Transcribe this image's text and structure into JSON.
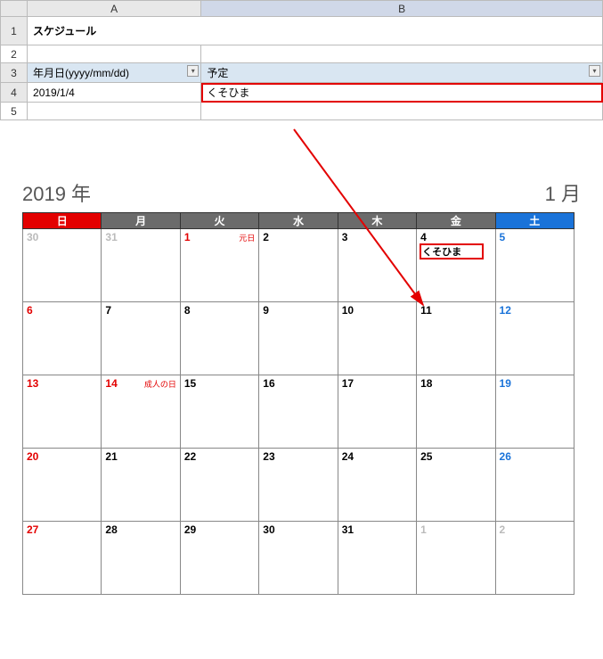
{
  "spreadsheet": {
    "columns": {
      "a": "A",
      "b": "B"
    },
    "rows": [
      "1",
      "2",
      "3",
      "4",
      "5"
    ],
    "title": "スケジュール",
    "header_date": "年月日(yyyy/mm/dd)",
    "header_plan": "予定",
    "data_date": "2019/1/4",
    "data_plan": "くそひま"
  },
  "calendar": {
    "year_label": "2019 年",
    "month_label": "1 月",
    "dow": {
      "sun": "日",
      "mon": "月",
      "tue": "火",
      "wed": "水",
      "thu": "木",
      "fri": "金",
      "sat": "土"
    },
    "weeks": [
      [
        {
          "n": "30",
          "cls": "other"
        },
        {
          "n": "31",
          "cls": "other"
        },
        {
          "n": "1",
          "cls": "holiday",
          "holiday": "元日"
        },
        {
          "n": "2",
          "cls": ""
        },
        {
          "n": "3",
          "cls": ""
        },
        {
          "n": "4",
          "cls": "",
          "event": "くそひま",
          "highlight": true
        },
        {
          "n": "5",
          "cls": "sat"
        }
      ],
      [
        {
          "n": "6",
          "cls": "sun"
        },
        {
          "n": "7",
          "cls": ""
        },
        {
          "n": "8",
          "cls": ""
        },
        {
          "n": "9",
          "cls": ""
        },
        {
          "n": "10",
          "cls": ""
        },
        {
          "n": "11",
          "cls": ""
        },
        {
          "n": "12",
          "cls": "sat"
        }
      ],
      [
        {
          "n": "13",
          "cls": "sun"
        },
        {
          "n": "14",
          "cls": "holiday",
          "holiday": "成人の日"
        },
        {
          "n": "15",
          "cls": ""
        },
        {
          "n": "16",
          "cls": ""
        },
        {
          "n": "17",
          "cls": ""
        },
        {
          "n": "18",
          "cls": ""
        },
        {
          "n": "19",
          "cls": "sat"
        }
      ],
      [
        {
          "n": "20",
          "cls": "sun"
        },
        {
          "n": "21",
          "cls": ""
        },
        {
          "n": "22",
          "cls": ""
        },
        {
          "n": "23",
          "cls": ""
        },
        {
          "n": "24",
          "cls": ""
        },
        {
          "n": "25",
          "cls": ""
        },
        {
          "n": "26",
          "cls": "sat"
        }
      ],
      [
        {
          "n": "27",
          "cls": "sun"
        },
        {
          "n": "28",
          "cls": ""
        },
        {
          "n": "29",
          "cls": ""
        },
        {
          "n": "30",
          "cls": ""
        },
        {
          "n": "31",
          "cls": ""
        },
        {
          "n": "1",
          "cls": "other"
        },
        {
          "n": "2",
          "cls": "other"
        }
      ]
    ]
  }
}
